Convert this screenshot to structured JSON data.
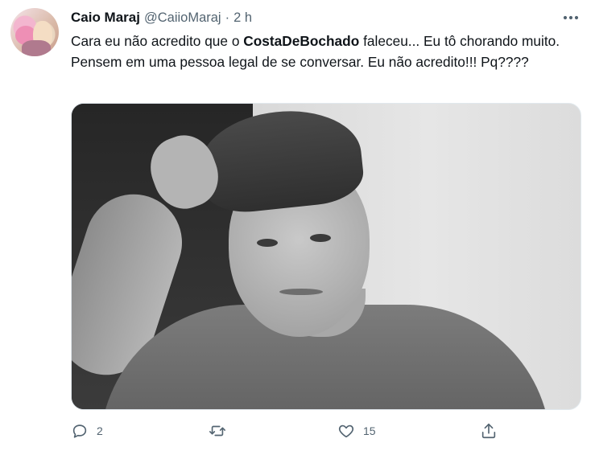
{
  "author": {
    "name": "Caio Maraj",
    "handle": "@CaiioMaraj",
    "separator": "·",
    "time": "2 h"
  },
  "tweet": {
    "text_before": "Cara eu não acredito que o ",
    "mention": "CostaDeBochado",
    "text_after": " faleceu... Eu tô chorando muito. Pensem em uma pessoa legal de se conversar. Eu não acredito!!! Pq????"
  },
  "media": {
    "description": "black-and-white photo of a young man with hand on his head"
  },
  "actions": {
    "reply_count": "2",
    "retweet_count": "",
    "like_count": "15"
  },
  "colors": {
    "text": "#0f1419",
    "secondary": "#536471"
  },
  "icons": [
    "more-icon",
    "reply-icon",
    "retweet-icon",
    "like-icon",
    "share-icon"
  ]
}
